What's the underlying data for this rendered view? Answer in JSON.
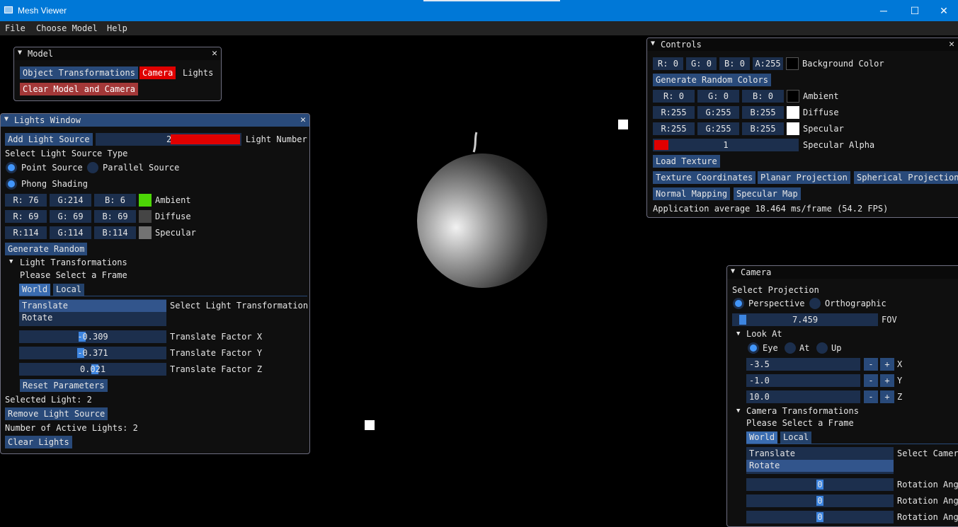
{
  "app": {
    "title": "Mesh Viewer"
  },
  "window_controls": {
    "minimize": "─",
    "maximize": "☐",
    "close": "✕"
  },
  "menu": [
    "File",
    "Choose Model",
    "Help"
  ],
  "model_window": {
    "title": "Model",
    "tabs": [
      "Object Transformations",
      "Camera",
      "Lights"
    ],
    "clear_button": "Clear Model and Camera"
  },
  "lights_window": {
    "title": "Lights Window",
    "add_button": "Add Light Source",
    "light_number_value": "2",
    "light_number_label": "Light Number",
    "select_type_label": "Select Light Source Type",
    "type_options": [
      "Point Source",
      "Parallel Source"
    ],
    "shading_option": "Phong Shading",
    "ambient": {
      "r": "R: 76",
      "g": "G:214",
      "b": "B:  6",
      "label": "Ambient",
      "color": "#4cd606"
    },
    "diffuse": {
      "r": "R: 69",
      "g": "G: 69",
      "b": "B: 69",
      "label": "Diffuse",
      "color": "#454545"
    },
    "specular": {
      "r": "R:114",
      "g": "G:114",
      "b": "B:114",
      "label": "Specular",
      "color": "#727272"
    },
    "generate_button": "Generate Random",
    "transformations_header": "Light Transformations",
    "select_frame": "Please Select a Frame",
    "frame_tabs": [
      "World",
      "Local"
    ],
    "transform_list": [
      "Translate",
      "Rotate"
    ],
    "transform_list_label": "Select Light Transformation",
    "sliders": [
      {
        "value": "-0.309",
        "label": "Translate Factor X"
      },
      {
        "value": "-0.371",
        "label": "Translate Factor Y"
      },
      {
        "value": "0.021",
        "label": "Translate Factor Z"
      }
    ],
    "reset_button": "Reset Parameters",
    "selected_light": "Selected Light: 2",
    "remove_button": "Remove Light Source",
    "active_lights": "Number of Active Lights: 2",
    "clear_button": "Clear Lights"
  },
  "controls_window": {
    "title": "Controls",
    "background": {
      "r": "R:  0",
      "g": "G:  0",
      "b": "B:  0",
      "a": "A:255",
      "label": "Background Color",
      "color": "#000000"
    },
    "random_colors_button": "Generate Random Colors",
    "ambient": {
      "r": "R:  0",
      "g": "G:  0",
      "b": "B:  0",
      "label": "Ambient",
      "color": "#000000"
    },
    "diffuse": {
      "r": "R:255",
      "g": "G:255",
      "b": "B:255",
      "label": "Diffuse",
      "color": "#ffffff"
    },
    "specular": {
      "r": "R:255",
      "g": "G:255",
      "b": "B:255",
      "label": "Specular",
      "color": "#ffffff"
    },
    "specular_alpha": {
      "value": "1",
      "label": "Specular Alpha"
    },
    "load_texture_button": "Load Texture",
    "texture_buttons": [
      "Texture Coordinates",
      "Planar Projection",
      "Spherical Projection"
    ],
    "mapping_buttons": [
      "Normal Mapping",
      "Specular Map"
    ],
    "fps_text": "Application average 18.464 ms/frame (54.2 FPS)"
  },
  "camera_window": {
    "title": "Camera",
    "select_projection": "Select Projection",
    "projection_options": [
      "Perspective",
      "Orthographic"
    ],
    "fov": {
      "value": "7.459",
      "label": "FOV"
    },
    "look_at_header": "Look At",
    "look_at_options": [
      "Eye",
      "At",
      "Up"
    ],
    "coords": [
      {
        "value": "-3.5",
        "label": "X"
      },
      {
        "value": "-1.0",
        "label": "Y"
      },
      {
        "value": "10.0",
        "label": "Z"
      }
    ],
    "stepper": {
      "minus": "-",
      "plus": "+"
    },
    "transformations_header": "Camera Transformations",
    "select_frame": "Please Select a Frame",
    "frame_tabs": [
      "World",
      "Local"
    ],
    "transform_list": [
      "Translate",
      "Rotate"
    ],
    "transform_list_label": "Select Camera",
    "rotation_sliders": [
      {
        "value": "0",
        "label": "Rotation Angl"
      },
      {
        "value": "0",
        "label": "Rotation Angl"
      },
      {
        "value": "0",
        "label": "Rotation Angl"
      }
    ]
  }
}
